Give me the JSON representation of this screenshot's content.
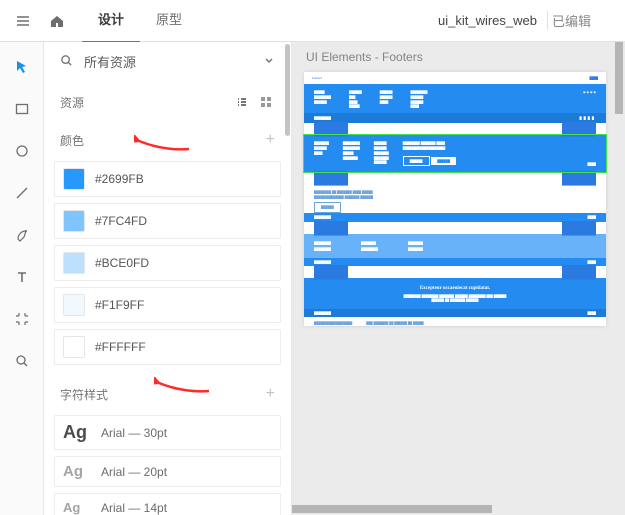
{
  "topbar": {
    "tabs": {
      "design": "设计",
      "prototype": "原型"
    },
    "doc_title": "ui_kit_wires_web",
    "status": "已编辑"
  },
  "tools": {
    "select": "select-tool",
    "rect": "rectangle-tool",
    "circle": "ellipse-tool",
    "line": "line-tool",
    "pen": "pen-tool",
    "text": "text-tool",
    "artboard": "artboard-tool",
    "zoom": "zoom-tool"
  },
  "panel": {
    "search_label": "所有资源",
    "sections": {
      "resources": "资源",
      "colors": "颜色",
      "char_styles": "字符样式"
    },
    "swatches": [
      {
        "hex": "#2699FB"
      },
      {
        "hex": "#7FC4FD"
      },
      {
        "hex": "#BCE0FD"
      },
      {
        "hex": "#F1F9FF"
      },
      {
        "hex": "#FFFFFF"
      }
    ],
    "char_styles": [
      {
        "label": "Arial — 30pt",
        "size": "18px",
        "dark": true
      },
      {
        "label": "Arial — 20pt",
        "size": "15px",
        "dark": false
      },
      {
        "label": "Arial — 14pt",
        "size": "13px",
        "dark": false
      }
    ]
  },
  "canvas": {
    "artboard_title": "UI Elements - Footers",
    "fE_title": "Excepteur occaeuiecat cupidatat."
  }
}
